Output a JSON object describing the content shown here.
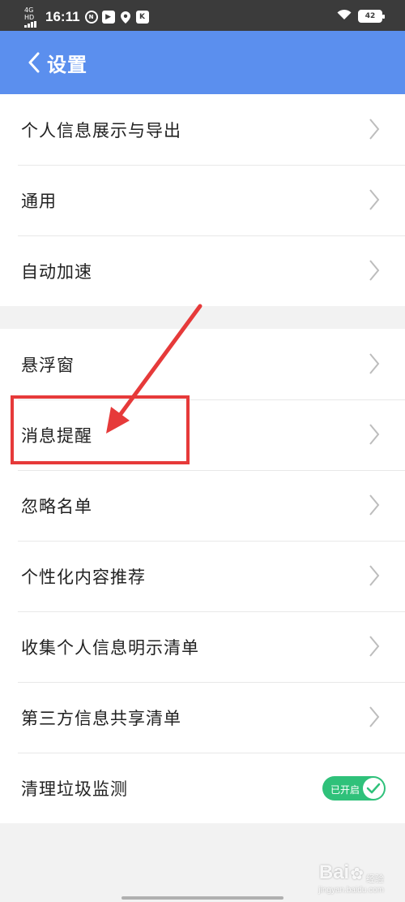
{
  "status_bar": {
    "network": "4G HD",
    "time": "16:11",
    "icons": [
      "nfc-icon",
      "video-icon",
      "location-icon",
      "k-app-icon"
    ],
    "battery": "42"
  },
  "header": {
    "back_icon": "chevron-left-icon",
    "title": "设置"
  },
  "settings": {
    "group1": [
      {
        "label": "个人信息展示与导出"
      },
      {
        "label": "通用"
      },
      {
        "label": "自动加速"
      }
    ],
    "group2": [
      {
        "label": "悬浮窗"
      },
      {
        "label": "消息提醒"
      },
      {
        "label": "忽略名单"
      },
      {
        "label": "个性化内容推荐"
      },
      {
        "label": "收集个人信息明示清单"
      },
      {
        "label": "第三方信息共享清单"
      },
      {
        "label": "清理垃圾监测",
        "toggle_label": "已开启",
        "toggle_on": true
      }
    ]
  },
  "annotation": {
    "color": "#e63a3a",
    "highlighted_item": "消息提醒"
  },
  "watermark": {
    "main": "Bai",
    "sub": "经验",
    "site": "jingyan.baidu.com"
  },
  "colors": {
    "accent": "#5b8fee",
    "toggle_on": "#2fc17a"
  }
}
